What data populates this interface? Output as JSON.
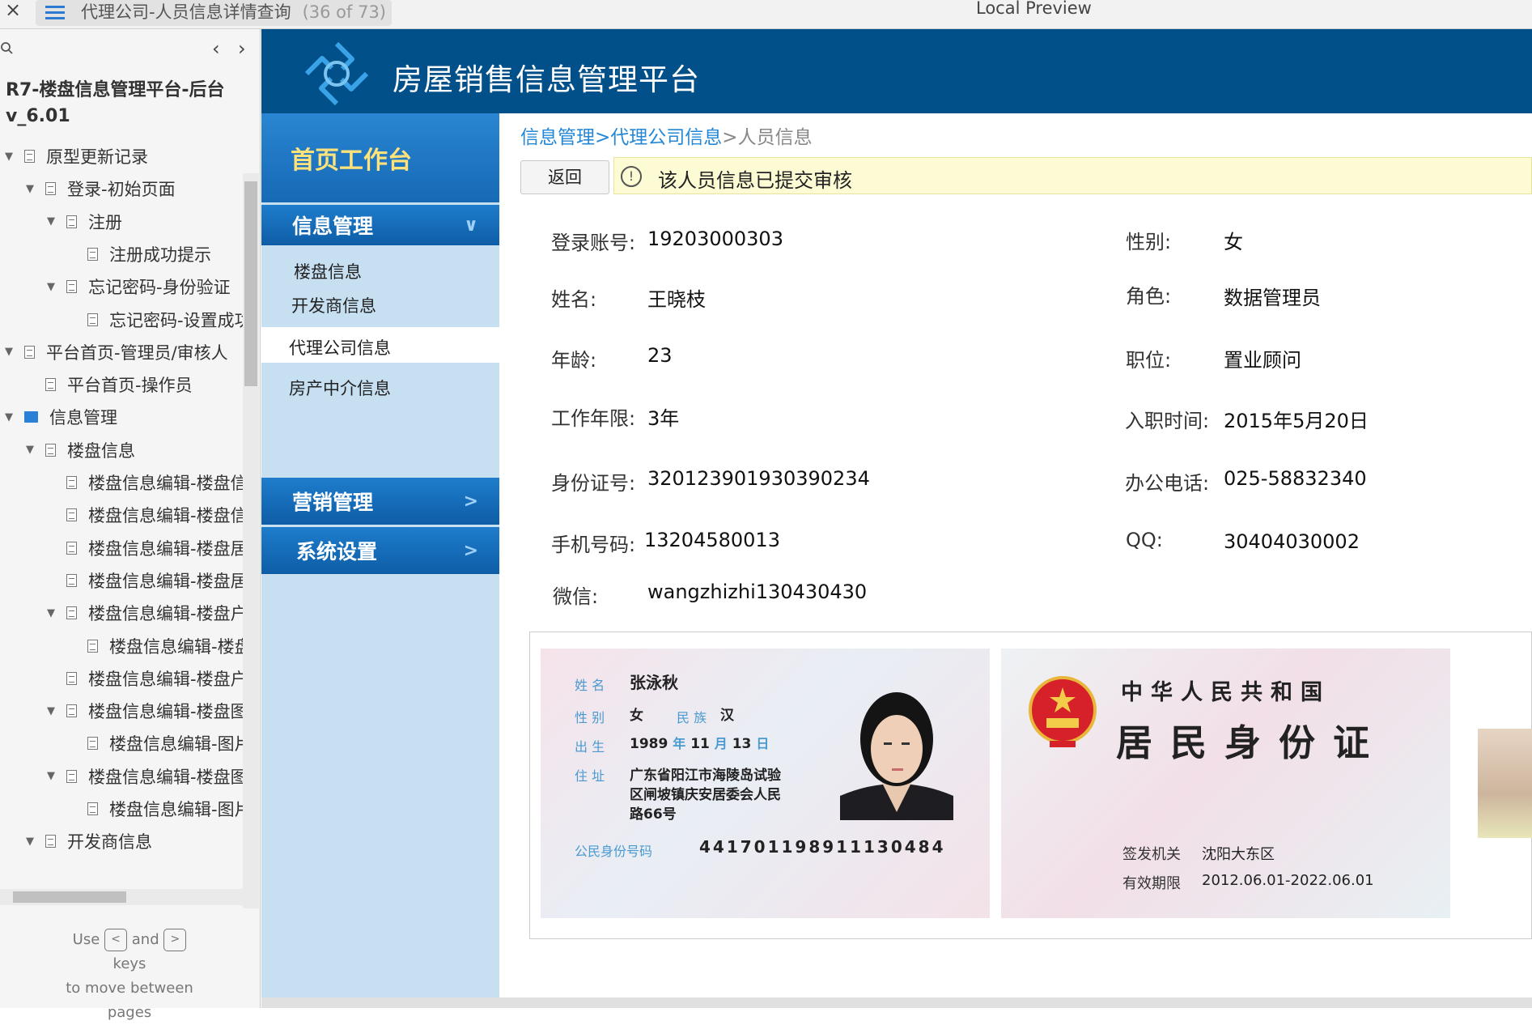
{
  "topbar": {
    "close": "×",
    "title": "代理公司-人员信息详情查询",
    "count": "(36 of 73)",
    "preview": "Local Preview"
  },
  "left": {
    "nav_prev": "‹",
    "nav_next": "›",
    "project_title": "R7-楼盘信息管理平台-后台 v_6.01",
    "tree": [
      {
        "label": "原型更新记录",
        "kind": "page",
        "arrow": "▼"
      },
      {
        "label": "登录-初始页面",
        "kind": "page",
        "arrow": "▼"
      },
      {
        "label": "注册",
        "kind": "page",
        "arrow": "▼"
      },
      {
        "label": "注册成功提示",
        "kind": "page",
        "arrow": ""
      },
      {
        "label": "忘记密码-身份验证",
        "kind": "page",
        "arrow": "▼"
      },
      {
        "label": "忘记密码-设置成功",
        "kind": "page",
        "arrow": ""
      },
      {
        "label": "平台首页-管理员/审核人",
        "kind": "page",
        "arrow": "▼"
      },
      {
        "label": "平台首页-操作员",
        "kind": "page",
        "arrow": ""
      },
      {
        "label": "信息管理",
        "kind": "folder",
        "arrow": "▼"
      },
      {
        "label": "楼盘信息",
        "kind": "page",
        "arrow": "▼"
      },
      {
        "label": "楼盘信息编辑-楼盘信",
        "kind": "page",
        "arrow": ""
      },
      {
        "label": "楼盘信息编辑-楼盘信",
        "kind": "page",
        "arrow": ""
      },
      {
        "label": "楼盘信息编辑-楼盘居",
        "kind": "page",
        "arrow": ""
      },
      {
        "label": "楼盘信息编辑-楼盘居",
        "kind": "page",
        "arrow": ""
      },
      {
        "label": "楼盘信息编辑-楼盘户",
        "kind": "page",
        "arrow": "▼"
      },
      {
        "label": "楼盘信息编辑-楼盘",
        "kind": "page",
        "arrow": ""
      },
      {
        "label": "楼盘信息编辑-楼盘户",
        "kind": "page",
        "arrow": ""
      },
      {
        "label": "楼盘信息编辑-楼盘图",
        "kind": "page",
        "arrow": "▼"
      },
      {
        "label": "楼盘信息编辑-图片",
        "kind": "page",
        "arrow": ""
      },
      {
        "label": "楼盘信息编辑-楼盘图",
        "kind": "page",
        "arrow": "▼"
      },
      {
        "label": "楼盘信息编辑-图片",
        "kind": "page",
        "arrow": ""
      },
      {
        "label": "开发商信息",
        "kind": "page",
        "arrow": "▼"
      }
    ],
    "help": {
      "use": "Use",
      "and": "and",
      "keys": "keys",
      "rest": "to move between pages",
      "key_prev": "<",
      "key_next": ">"
    }
  },
  "app": {
    "title": "房屋销售信息管理平台",
    "nav": {
      "home": "首页工作台",
      "info_mgmt": "信息管理",
      "info_items": [
        "楼盘信息",
        "开发商信息",
        "代理公司信息",
        "房产中介信息"
      ],
      "marketing": "营销管理",
      "settings": "系统设置",
      "chev_down": "∨",
      "chev_right": ">"
    },
    "breadcrumb": {
      "a": "信息管理",
      "sep1": ">",
      "b": "代理公司信息",
      "sep2": ">",
      "c": "人员信息"
    },
    "back": "返回",
    "notice": "该人员信息已提交审核",
    "fields": {
      "account_l": "登录账号:",
      "account_v": "19203000303",
      "gender_l": "性别:",
      "gender_v": "女",
      "name_l": "姓名:",
      "name_v": "王晓枝",
      "role_l": "角色:",
      "role_v": "数据管理员",
      "age_l": "年龄:",
      "age_v": "23",
      "position_l": "职位:",
      "position_v": "置业顾问",
      "years_l": "工作年限:",
      "years_v": "3年",
      "joined_l": "入职时间:",
      "joined_v": "2015年5月20日",
      "idno_l": "身份证号:",
      "idno_v": "320123901930390234",
      "office_l": "办公电话:",
      "office_v": "025-58832340",
      "mobile_l": "手机号码:",
      "mobile_v": "13204580013",
      "qq_l": "QQ:",
      "qq_v": "30404030002",
      "wechat_l": "微信:",
      "wechat_v": "wangzhizhi130430430"
    },
    "idcard": {
      "name_l": "姓 名",
      "name_v": "张泳秋",
      "sex_l": "性 别",
      "sex_v": "女",
      "eth_l": "民 族",
      "eth_v": "汉",
      "birth_l": "出 生",
      "birth_y": "1989",
      "y": "年",
      "birth_m": "11",
      "m": "月",
      "birth_d": "13",
      "d": "日",
      "addr_l": "住 址",
      "addr_v1": "广东省阳江市海陵岛试验",
      "addr_v2": "区闸坡镇庆安居委会人民",
      "addr_v3": "路66号",
      "num_l": "公民身份号码",
      "num_v": "441701198911130484",
      "country": "中华人民共和国",
      "card": "居民身份证",
      "issuer_l": "签发机关",
      "issuer_v": "沈阳大东区",
      "valid_l": "有效期限",
      "valid_v": "2012.06.01-2022.06.01"
    }
  }
}
